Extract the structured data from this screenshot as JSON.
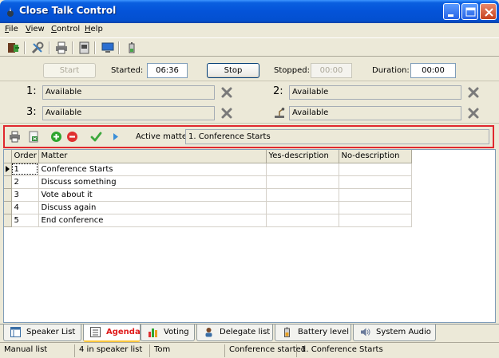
{
  "window": {
    "title": "Close Talk Control"
  },
  "menu": [
    {
      "label": "File",
      "key": "F",
      "rest": "ile"
    },
    {
      "label": "View",
      "key": "V",
      "rest": "iew"
    },
    {
      "label": "Control",
      "key": "C",
      "rest": "ontrol"
    },
    {
      "label": "Help",
      "key": "H",
      "rest": "elp"
    }
  ],
  "toolbar_icons": [
    "exit-icon",
    "settings-icon",
    "print-icon",
    "report-icon",
    "monitor-icon",
    "battery-icon"
  ],
  "timer": {
    "start_label": "Start",
    "started_label": "Started:",
    "started_value": "06:36",
    "stop_label": "Stop",
    "stopped_label": "Stopped:",
    "stopped_value": "00:00",
    "duration_label": "Duration:",
    "duration_value": "00:00"
  },
  "speakers": [
    {
      "num": "1:",
      "value": "Available"
    },
    {
      "num": "3:",
      "value": "Available"
    },
    {
      "num": "2:",
      "value": "Available"
    },
    {
      "num": "",
      "value": "Available"
    }
  ],
  "agenda": {
    "active_label": "Active matter:",
    "active_value": "1. Conference Starts",
    "columns": [
      "Order",
      "Matter",
      "Yes-description",
      "No-description"
    ],
    "rows": [
      {
        "order": "1",
        "matter": "Conference Starts",
        "yes": "",
        "no": ""
      },
      {
        "order": "2",
        "matter": "Discuss something",
        "yes": "",
        "no": ""
      },
      {
        "order": "3",
        "matter": "Vote about it",
        "yes": "",
        "no": ""
      },
      {
        "order": "4",
        "matter": "Discuss again",
        "yes": "",
        "no": ""
      },
      {
        "order": "5",
        "matter": "End conference",
        "yes": "",
        "no": ""
      }
    ]
  },
  "tabs": [
    {
      "label": "Speaker List",
      "icon": "speaker-list-icon"
    },
    {
      "label": "Agenda",
      "icon": "agenda-icon",
      "active": true
    },
    {
      "label": "Voting",
      "icon": "voting-chart-icon"
    },
    {
      "label": "Delegate list",
      "icon": "delegate-icon"
    },
    {
      "label": "Battery level",
      "icon": "battery-icon"
    },
    {
      "label": "System Audio",
      "icon": "audio-icon"
    }
  ],
  "status": {
    "mode": "Manual list",
    "speakers": "4 in speaker list",
    "user": "Tom",
    "state": "Conference started",
    "matter": "1. Conference Starts"
  }
}
